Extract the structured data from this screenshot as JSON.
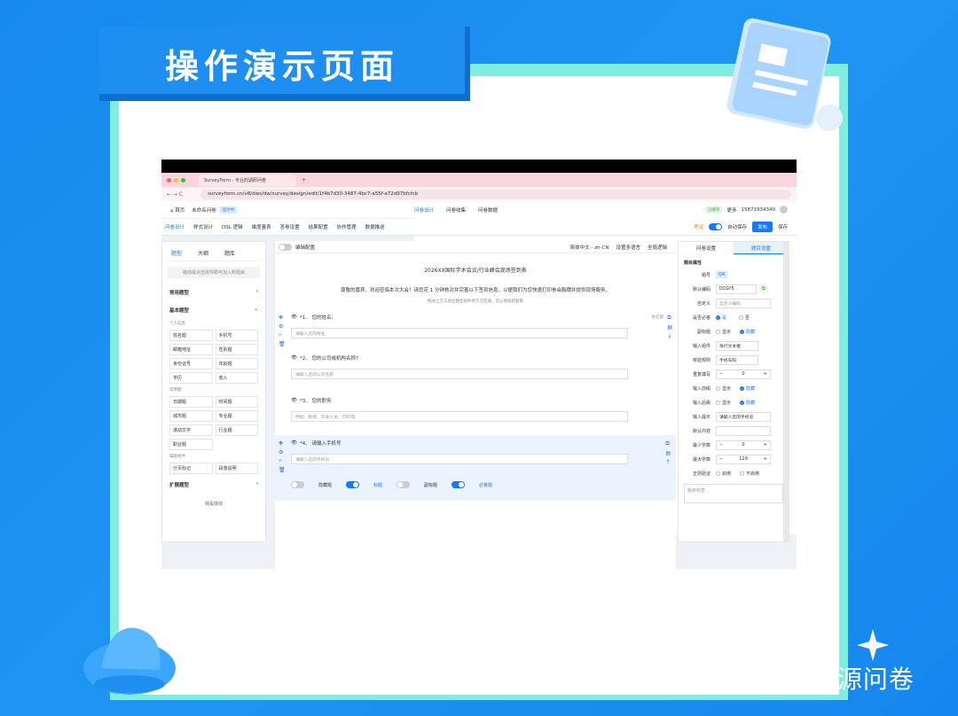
{
  "title": "操作演示页面",
  "watermark": "知乎 @调问开源问卷",
  "browser": {
    "tab_title": "SurveyForm - 专业的调研问卷",
    "url": "surveyform.cn/v8/dws/dw/survey/design/edit/1f4b7d30-3487-4bc7-a55f-a72d97bfcfcb"
  },
  "appnav": {
    "home": "首页",
    "survey_name": "未命名问卷",
    "badge": "设计中",
    "tabs": [
      "问卷设计",
      "问卷收集",
      "问卷数据"
    ],
    "status": "已保存",
    "more": "更多",
    "phone": "15871934340"
  },
  "toolbar": {
    "items": [
      "问卷设计",
      "样式设计",
      "DSL 逻辑",
      "维度量表",
      "答卷设置",
      "结果配置",
      "协作管理",
      "数据推送"
    ],
    "exam": "考试",
    "autosave": "自动保存",
    "publish": "发布",
    "save": "保存"
  },
  "left": {
    "tabs": [
      "题型",
      "大纲",
      "题库"
    ],
    "hint": "拖动或点击控件即可加入新题目",
    "sec_common": "常用题型",
    "sec_basic": "基本题型",
    "sub_personal": "个人信息",
    "personal": [
      "姓名题",
      "手机号",
      "邮箱地址",
      "性别题",
      "身份证号",
      "年龄题",
      "学历",
      "收入"
    ],
    "sub_common": "常用题",
    "common": [
      "日期题",
      "时间题",
      "城市题",
      "专业题",
      "滚动文字",
      "行业题",
      "职业题"
    ],
    "sub_aux": "辅助组件",
    "aux": [
      "分页标记",
      "段落说明"
    ],
    "sec_ext": "扩展题型",
    "divider": "我是底线"
  },
  "center": {
    "edit_label": "编辑配置",
    "lang": "简体中文 - zh-CN",
    "multi_lang": "设置多语言",
    "logic": "全局逻辑",
    "form_title": "2026XX国际学术会议/行业峰会现场签到表",
    "welcome": "尊敬的嘉宾，欢迎莅临本次大会！请您花 1 分钟核对并完善以下签到信息，以便我们为您快速打印参会胸牌并提供现场服务。",
    "tip": "拖动上方工具栏题型组件到下方区域，可以增加新题目",
    "questions": [
      {
        "title": "*1、 您的姓名：",
        "placeholder": "请输入您的姓名",
        "tag": "姓名题"
      },
      {
        "title": "*2、 您的公司或机构名称?",
        "placeholder": "请输入您的公司名称"
      },
      {
        "title": "*3、 您的职务",
        "placeholder": "例如：教授、开发人员、CEO等"
      },
      {
        "title": "*4、 请输入手机号",
        "placeholder": "请输入您的手机号"
      }
    ],
    "toggles": [
      "隐藏题",
      "标题",
      "副标题",
      "必答题"
    ]
  },
  "right": {
    "tabs": [
      "问卷设置",
      "题目设置"
    ],
    "section": "题目属性",
    "q_no_label": "题号",
    "q_no": "Q4",
    "code_label": "默认编码",
    "code": "DCGY5",
    "custom_label": "自定义",
    "custom_ph": "自定义编码",
    "required_label": "是否必答",
    "yes": "是",
    "no": "否",
    "subtitle_label": "副标题",
    "show": "显示",
    "hide": "隐藏",
    "component_label": "输入组件",
    "component": "单行文本框",
    "validate_label": "校验规则",
    "validate": "手机号码",
    "repeat_label": "重复填写",
    "repeat": "0",
    "prefix_label": "输入前缀",
    "suffix_label": "输入后缀",
    "prompt_label": "输入提示",
    "prompt": "请输入您的手机号",
    "default_label": "默认内容",
    "min_label": "最少字数",
    "min": "0",
    "max_label": "最大字数",
    "max": "119",
    "regex_label": "正则验证",
    "enable": "启用",
    "disable": "不启用",
    "subtitle_ph": "题目标签"
  }
}
